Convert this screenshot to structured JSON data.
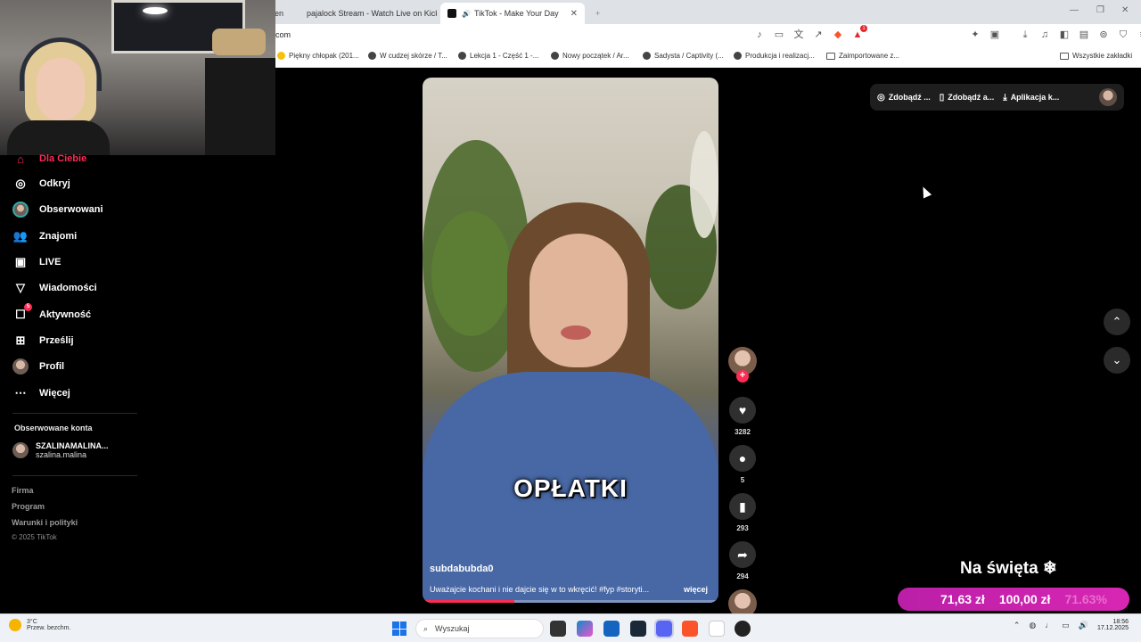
{
  "browser": {
    "tabs": [
      {
        "label": "en"
      },
      {
        "label": "pajalock Stream - Watch Live on Kick"
      },
      {
        "label": "TikTok - Make Your Day",
        "active": true
      }
    ],
    "url": "com",
    "bookmarks": [
      "Piękny chłopak (201...",
      "W cudzej skórze / T...",
      "Lekcja 1 - Część 1 -...",
      "Nowy początek / Ar...",
      "Sadysta / Captivity (...",
      "Produkcja i realizacj...",
      "Zaimportowane z...",
      "Wszystkie zakładki"
    ],
    "extension_badge": "1"
  },
  "sidebar": {
    "items": [
      {
        "label": "Dla Ciebie",
        "icon": "home-icon"
      },
      {
        "label": "Odkryj",
        "icon": "compass-icon"
      },
      {
        "label": "Obserwowani",
        "icon": "avatar"
      },
      {
        "label": "Znajomi",
        "icon": "friends-icon"
      },
      {
        "label": "LIVE",
        "icon": "live-icon"
      },
      {
        "label": "Wiadomości",
        "icon": "send-icon"
      },
      {
        "label": "Aktywność",
        "icon": "activity-icon",
        "badge": "5"
      },
      {
        "label": "Prześlij",
        "icon": "upload-icon"
      },
      {
        "label": "Profil",
        "icon": "avatar"
      },
      {
        "label": "Więcej",
        "icon": "more-icon"
      }
    ],
    "followed_title": "Obserwowane konta",
    "followed": {
      "name": "SZALINAMALINA...",
      "handle": "szalina.malina"
    },
    "footer": [
      "Firma",
      "Program",
      "Warunki i polityki"
    ],
    "copyright": "© 2025 TikTok"
  },
  "video": {
    "caption": "OPŁATKI",
    "username": "subdabubda0",
    "description": "Uważajcie kochani i nie dajcie się w to wkręcić! #fyp #storyti...",
    "more": "więcej",
    "progress": 0.31
  },
  "actions": {
    "likes": "3282",
    "comments": "5",
    "saves": "293",
    "shares": "294",
    "follow": "+"
  },
  "topbar": {
    "items": [
      "Zdobądź ...",
      "Zdobądź a...",
      "Aplikacja k..."
    ]
  },
  "promo": {
    "title": "Na święta ❄",
    "current": "71,63 zł",
    "goal": "100,00 zł",
    "percent": "71.63%"
  },
  "taskbar": {
    "temp": "3°C",
    "weather": "Przew. bezchm.",
    "search_placeholder": "Wyszukaj",
    "time": "18:56",
    "date": "17.12.2025"
  }
}
